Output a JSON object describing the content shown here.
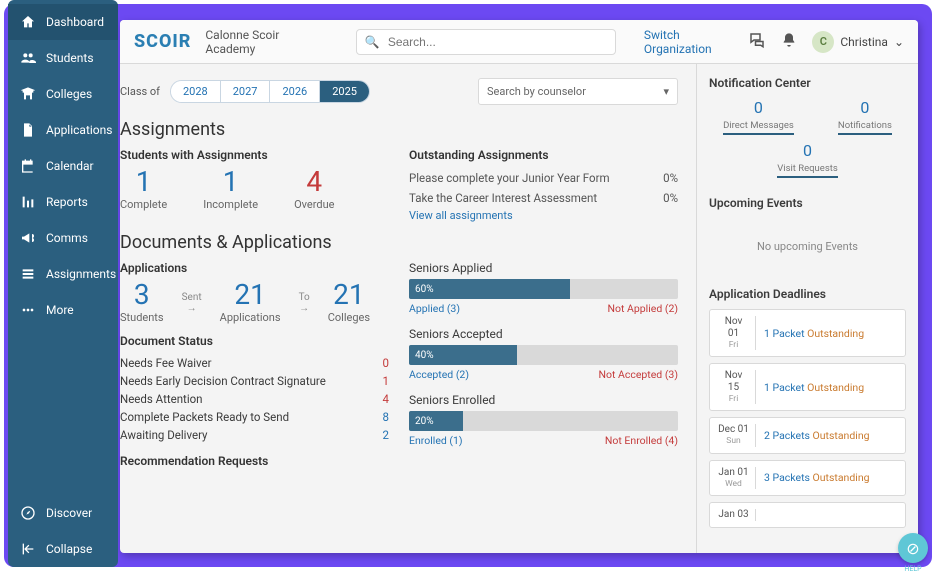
{
  "brand": "SCOIR",
  "org_name": "Calonne Scoir Academy",
  "search": {
    "placeholder": "Search..."
  },
  "top": {
    "switch_org": "Switch Organization",
    "user_name": "Christina",
    "user_initial": "C"
  },
  "sidebar": {
    "items": [
      {
        "icon": "home",
        "label": "Dashboard",
        "active": true
      },
      {
        "icon": "users",
        "label": "Students",
        "active": false
      },
      {
        "icon": "college",
        "label": "Colleges",
        "active": false
      },
      {
        "icon": "doc",
        "label": "Applications",
        "active": false
      },
      {
        "icon": "calendar",
        "label": "Calendar",
        "active": false
      },
      {
        "icon": "chart",
        "label": "Reports",
        "active": false
      },
      {
        "icon": "megaphone",
        "label": "Comms",
        "active": false
      },
      {
        "icon": "list",
        "label": "Assignments",
        "active": false
      },
      {
        "icon": "dots",
        "label": "More",
        "active": false
      }
    ],
    "discover": "Discover",
    "collapse": "Collapse"
  },
  "class_of": {
    "label": "Class of",
    "years": [
      "2028",
      "2027",
      "2026",
      "2025"
    ],
    "active": "2025"
  },
  "counselor_select": "Search by counselor",
  "assignments": {
    "heading": "Assignments",
    "students_heading": "Students with Assignments",
    "metrics": [
      {
        "n": "1",
        "label": "Complete"
      },
      {
        "n": "1",
        "label": "Incomplete"
      },
      {
        "n": "4",
        "label": "Overdue",
        "variant": "over"
      }
    ],
    "outstanding_heading": "Outstanding Assignments",
    "outstanding": [
      {
        "text": "Please complete your Junior Year Form",
        "pct": "0%"
      },
      {
        "text": "Take the Career Interest Assessment",
        "pct": "0%"
      }
    ],
    "view_all": "View all assignments"
  },
  "docs": {
    "heading": "Documents & Applications",
    "apps_heading": "Applications",
    "metrics": [
      {
        "n": "3",
        "label": "Students"
      },
      {
        "arrow": "Sent"
      },
      {
        "n": "21",
        "label": "Applications"
      },
      {
        "arrow": "To"
      },
      {
        "n": "21",
        "label": "Colleges"
      }
    ],
    "status_heading": "Document Status",
    "status_rows": [
      {
        "label": "Needs Fee Waiver",
        "v": "0",
        "blue": false
      },
      {
        "label": "Needs Early Decision Contract Signature",
        "v": "1",
        "blue": false
      },
      {
        "label": "Needs Attention",
        "v": "4",
        "blue": false
      },
      {
        "label": "Complete Packets Ready to Send",
        "v": "8",
        "blue": true
      },
      {
        "label": "Awaiting Delivery",
        "v": "2",
        "blue": true
      }
    ],
    "rec_heading": "Recommendation Requests"
  },
  "seniors": [
    {
      "title": "Seniors Applied",
      "pct": 60,
      "pct_label": "60%",
      "left": "Applied (3)",
      "right": "Not Applied (2)"
    },
    {
      "title": "Seniors Accepted",
      "pct": 40,
      "pct_label": "40%",
      "left": "Accepted (2)",
      "right": "Not Accepted (3)"
    },
    {
      "title": "Seniors Enrolled",
      "pct": 20,
      "pct_label": "20%",
      "left": "Enrolled (1)",
      "right": "Not Enrolled (4)"
    }
  ],
  "notif": {
    "heading": "Notification Center",
    "counts": [
      {
        "n": "0",
        "label": "Direct Messages"
      },
      {
        "n": "0",
        "label": "Notifications"
      },
      {
        "n": "0",
        "label": "Visit Requests"
      }
    ]
  },
  "events": {
    "heading": "Upcoming Events",
    "empty": "No upcoming Events"
  },
  "deadlines": {
    "heading": "Application Deadlines",
    "rows": [
      {
        "date": "Nov 01",
        "dow": "Fri",
        "n": "1 Packet",
        "status": "Outstanding"
      },
      {
        "date": "Nov 15",
        "dow": "Fri",
        "n": "1 Packet",
        "status": "Outstanding"
      },
      {
        "date": "Dec 01",
        "dow": "Sun",
        "n": "2 Packets",
        "status": "Outstanding"
      },
      {
        "date": "Jan 01",
        "dow": "Wed",
        "n": "3 Packets",
        "status": "Outstanding"
      },
      {
        "date": "Jan 03",
        "dow": "",
        "n": "",
        "status": ""
      }
    ]
  },
  "help_label": "HELP"
}
